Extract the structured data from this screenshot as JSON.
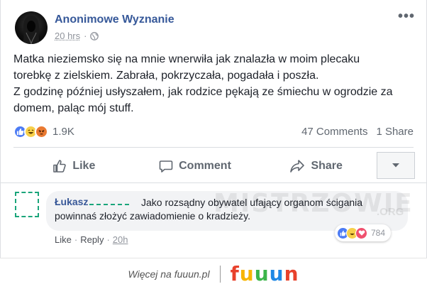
{
  "post": {
    "page_name": "Anonimowe Wyznanie",
    "time": "20 hrs",
    "separator": "·",
    "text_lines": [
      "Matka nieziemsko się na mnie wnerwiła jak znalazła w moim plecaku",
      "torebkę z zielskiem. Zabrała, pokrzyczała, pogadała i poszła.",
      "Z godzinę później usłyszałem, jak rodzice pękają ze śmiechu w ogrodzie za",
      "domem, paląc mój stuff."
    ],
    "reaction_icons": [
      "like-icon",
      "haha-icon",
      "angry-icon"
    ],
    "reaction_count": "1.9K",
    "comments_count": "47 Comments",
    "shares_count": "1 Share"
  },
  "actions": {
    "like": "Like",
    "comment": "Comment",
    "share": "Share"
  },
  "comment": {
    "author": "Łukasz",
    "text": "Jako rozsądny obywatel ufający organom ścigania powinnaś złożyć zawiadomienie o kradzieży.",
    "reaction_count": "784",
    "like": "Like",
    "reply": "Reply",
    "separator": "·",
    "time": "20h"
  },
  "watermark": {
    "text": "MISTRZOWIE",
    "tld": ".ORG"
  },
  "footer": {
    "text": "Więcej na fuuun.pl",
    "logo": "fuuun",
    "logo_colors": [
      "#e8412c",
      "#f7b500",
      "#3cb54a",
      "#1e88e5",
      "#e8412c"
    ]
  },
  "colors": {
    "link": "#365899",
    "meta": "#90949c",
    "like_blue": "#4d7cf4",
    "haha_yellow": "#f7d04a",
    "angry_orange": "#ea7a32",
    "love_red": "#f0506e"
  }
}
